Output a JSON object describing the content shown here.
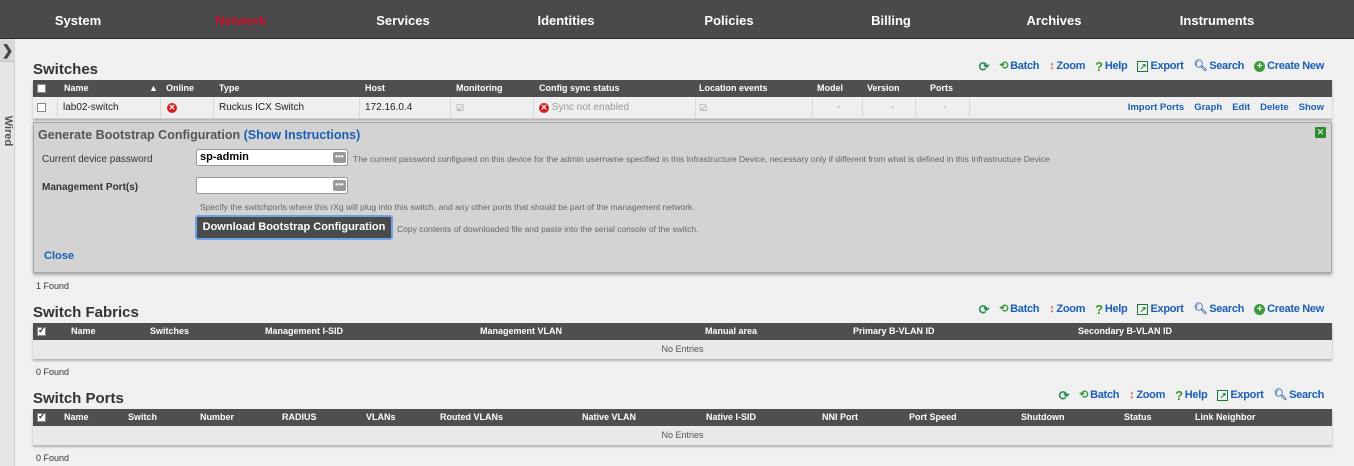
{
  "nav": [
    "System",
    "Network",
    "Services",
    "Identities",
    "Policies",
    "Billing",
    "Archives",
    "Instruments"
  ],
  "nav_active": "Network",
  "sidebar": {
    "toggle": "❯",
    "label": "Wired"
  },
  "toolbar": {
    "batch": "Batch",
    "zoom": "Zoom",
    "help": "Help",
    "export": "Export",
    "search": "Search",
    "create": "Create New"
  },
  "switches": {
    "title": "Switches",
    "headers": [
      "Name",
      "Online",
      "Type",
      "Host",
      "Monitoring",
      "Config sync status",
      "Location events",
      "Model",
      "Version",
      "Ports"
    ],
    "row": {
      "name": "lab02-switch",
      "type": "Ruckus ICX Switch",
      "host": "172.16.0.4",
      "sync": "Sync not enabled",
      "model": "-",
      "version": "-",
      "ports": "-",
      "actions": [
        "Import Ports",
        "Graph",
        "Edit",
        "Delete",
        "Show"
      ]
    },
    "found": "1 Found"
  },
  "bootstrap": {
    "title": "Generate Bootstrap Configuration",
    "show_instructions": "(Show Instructions)",
    "password_label": "Current device password",
    "password_value": "sp-admin",
    "password_hint": "The current password configured on this device for the admin username specified in this Infrastructure Device, necessary only if different from what is defined in this Infrastructure Device",
    "mgmt_label": "Management Port(s)",
    "mgmt_value": "",
    "mgmt_hint": "Specify the switchports where this rXg will plug into this switch, and any other ports that should be part of the management network.",
    "download_button": "Download Bootstrap Configuration",
    "download_hint": "Copy contents of downloaded file and paste into the serial console of the switch.",
    "close": "Close",
    "dots": "•••",
    "close_x": "✕"
  },
  "fabrics": {
    "title": "Switch Fabrics",
    "headers": [
      "Name",
      "Switches",
      "Management I-SID",
      "Management VLAN",
      "Manual area",
      "Primary B-VLAN ID",
      "Secondary B-VLAN ID"
    ],
    "empty": "No Entries",
    "found": "0 Found"
  },
  "ports": {
    "title": "Switch Ports",
    "headers": [
      "Name",
      "Switch",
      "Number",
      "RADIUS",
      "VLANs",
      "Routed VLANs",
      "Native VLAN",
      "Native I-SID",
      "NNI Port",
      "Port Speed",
      "Shutdown",
      "Status",
      "Link Neighbor"
    ],
    "empty": "No Entries",
    "found": "0 Found"
  },
  "colors": {
    "nav_bg": "#4a4a4a",
    "active": "#c8102e",
    "link": "#1a5fb4",
    "header_bg": "#4f4f4f"
  }
}
